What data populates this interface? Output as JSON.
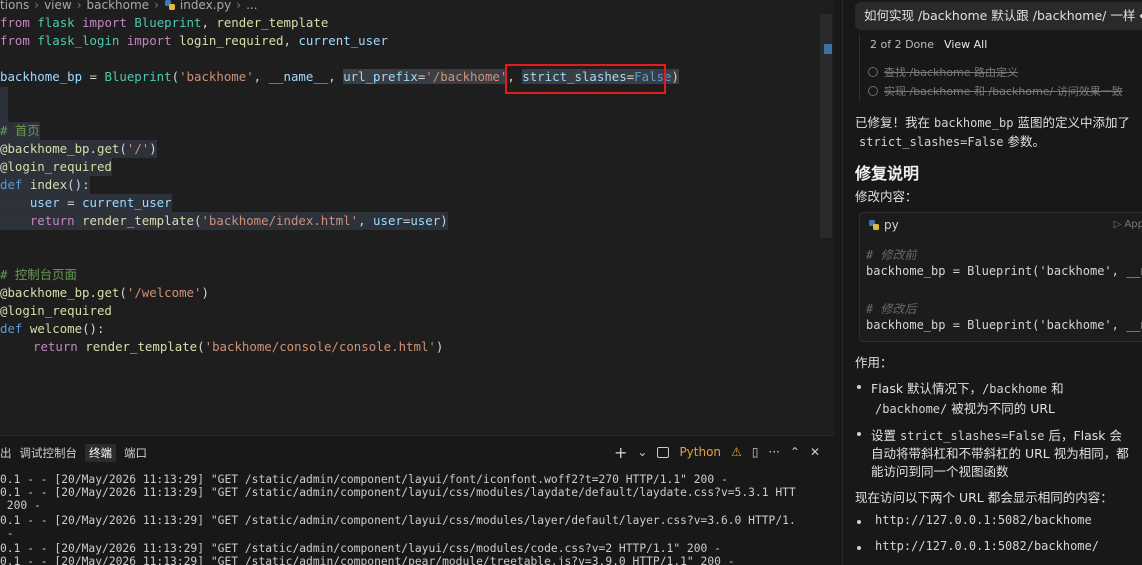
{
  "breadcrumb": {
    "items": [
      "tions",
      "view",
      "backhome",
      "index.py",
      "..."
    ]
  },
  "editor": {
    "line1": {
      "kw_from": "from",
      "mod": "flask",
      "kw_import": "import",
      "a": "Blueprint",
      "comma": ", ",
      "b": "render_template"
    },
    "line2": {
      "kw_from": "from",
      "mod": "flask_login",
      "kw_import": "import",
      "a": "login_required",
      "comma": ", ",
      "b": "current_user"
    },
    "line4": {
      "var": "backhome_bp",
      "eq": " = ",
      "cls": "Blueprint",
      "p1": "(",
      "s1": "'backhome'",
      "c1": ", ",
      "name": "__name__",
      "c2": ", ",
      "prm1": "url_prefix",
      "e1": "=",
      "s2": "'/backhome'",
      "c3": ", ",
      "prm2": "strict_slashes",
      "e2": "=",
      "bool": "False",
      "p2": ")"
    },
    "line7": "# 首页",
    "line8": {
      "dec": "@backhome_bp",
      "dot": ".",
      "fn": "get",
      "p1": "(",
      "s": "'/'",
      "p2": ")"
    },
    "line9": "@login_required",
    "line10": {
      "kw": "def",
      "fn": "index",
      "rest": "():"
    },
    "line11": {
      "ws": "····",
      "v": "user",
      "eq": " = ",
      "val": "current_user"
    },
    "line12": {
      "ws": "····",
      "kw": "return",
      "fn": "render_template",
      "p1": "(",
      "s": "'backhome/index.html'",
      "c": ", ",
      "k": "user",
      "e": "=",
      "v": "user",
      "p2": ")"
    },
    "line15": "# 控制台页面",
    "line16": {
      "dec": "@backhome_bp",
      "dot": ".",
      "fn": "get",
      "p1": "(",
      "s": "'/welcome'",
      "p2": ")"
    },
    "line17": "@login_required",
    "line18": {
      "kw": "def",
      "fn": "welcome",
      "rest": "():"
    },
    "line19": {
      "kw": "return",
      "fn": "render_template",
      "p1": "(",
      "s": "'backhome/console/console.html'",
      "p2": ")"
    }
  },
  "panel": {
    "tabs": [
      "出",
      "调试控制台",
      "终端",
      "端口"
    ],
    "active_tab": "终端",
    "tools": {
      "plus": "+",
      "caret": "⌄",
      "terminal_label": "Python",
      "warn": "⚠",
      "split": "▯",
      "more": "···",
      "up": "⌃",
      "close": "✕"
    },
    "lines": [
      "0.1 - - [20/May/2026 11:13:29] \"GET /static/admin/component/layui/font/iconfont.woff2?t=270 HTTP/1.1\" 200 -",
      "0.1 - - [20/May/2026 11:13:29] \"GET /static/admin/component/layui/css/modules/laydate/default/laydate.css?v=5.3.1 HTT",
      " 200 -",
      "0.1 - - [20/May/2026 11:13:29] \"GET /static/admin/component/layui/css/modules/layer/default/layer.css?v=3.6.0 HTTP/1.",
      " -",
      "0.1 - - [20/May/2026 11:13:29] \"GET /static/admin/component/layui/css/modules/code.css?v=2 HTTP/1.1\" 200 -",
      "0.1 - - [20/May/2026 11:13:29] \"GET /static/admin/component/pear/module/treetable.js?v=3.9.0 HTTP/1.1\" 200 -"
    ]
  },
  "chat": {
    "question": "如何实现 /backhome 默认跟 /backhome/ 一样 ↵",
    "todo": {
      "count": "2 of 2 Done",
      "view_all": "View All",
      "items": [
        "查找 /backhome 路由定义",
        "实现 /backhome 和 /backhome/ 访问效果一致"
      ]
    },
    "reply1_a": "已修复！我在 ",
    "reply1_code": "backhome_bp",
    "reply1_b": " 蓝图的定义中添加了",
    "reply2_code": "strict_slashes=False",
    "reply2_b": " 参数。",
    "fix_title": "修复说明",
    "change_label": "修改内容：",
    "code_card": {
      "lang": "py",
      "apply": "▷ App",
      "before_cmt": "# 修改前",
      "line_before": "backhome_bp = Blueprint('backhome', __n",
      "after_cmt": "# 修改后",
      "line_after": "backhome_bp = Blueprint('backhome', __n"
    },
    "effect_label": "作用：",
    "b1_a": "Flask 默认情况下，",
    "b1_code1": "/backhome",
    "b1_b": " 和",
    "b1_code2": "/backhome/",
    "b1_c": " 被视为不同的 URL",
    "b2_a": "设置 ",
    "b2_code": "strict_slashes=False",
    "b2_b": " 后，Flask 会",
    "b2_line2": "自动将带斜杠和不带斜杠的 URL 视为相同，都",
    "b2_line3": "能访问到同一个视图函数",
    "now_label": "现在访问以下两个 URL 都会显示相同的内容：",
    "url1": "http://127.0.0.1:5082/backhome",
    "url2": "http://127.0.0.1:5082/backhome/"
  }
}
